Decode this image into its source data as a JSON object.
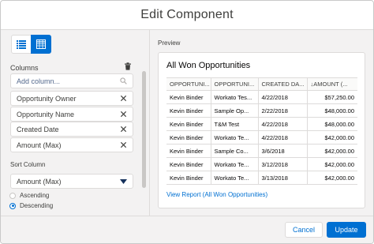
{
  "modal": {
    "title": "Edit Component"
  },
  "left": {
    "columns_label": "Columns",
    "add_column_placeholder": "Add column...",
    "columns": [
      "Opportunity Owner",
      "Opportunity Name",
      "Created Date",
      "Amount (Max)"
    ],
    "sort_label": "Sort Column",
    "sort_value": "Amount (Max)",
    "sort_options": [
      "Ascending",
      "Descending"
    ],
    "sort_selected": "Descending"
  },
  "preview": {
    "label": "Preview",
    "title": "All Won Opportunities",
    "headers": [
      "OPPORTUNI...",
      "OPPORTUNI...",
      "CREATED DA...",
      "↓AMOUNT (..."
    ],
    "rows": [
      [
        "Kevin Binder",
        "Workato Tes...",
        "4/22/2018",
        "$57,250.00"
      ],
      [
        "Kevin Binder",
        "Sample Op...",
        "2/22/2018",
        "$48,000.00"
      ],
      [
        "Kevin Binder",
        "T&M Test",
        "4/22/2018",
        "$48,000.00"
      ],
      [
        "Kevin Binder",
        "Workato Te...",
        "4/22/2018",
        "$42,000.00"
      ],
      [
        "Kevin Binder",
        "Sample Co...",
        "3/6/2018",
        "$42,000.00"
      ],
      [
        "Kevin Binder",
        "Workato Te...",
        "3/12/2018",
        "$42,000.00"
      ],
      [
        "Kevin Binder",
        "Workato Te...",
        "3/13/2018",
        "$42,000.00"
      ]
    ],
    "view_link": "View Report (All Won Opportunities)"
  },
  "footer": {
    "cancel": "Cancel",
    "update": "Update"
  },
  "colors": {
    "brand": "#0070d2",
    "panel_bg": "#f3f2f2",
    "border": "#dddbda"
  }
}
